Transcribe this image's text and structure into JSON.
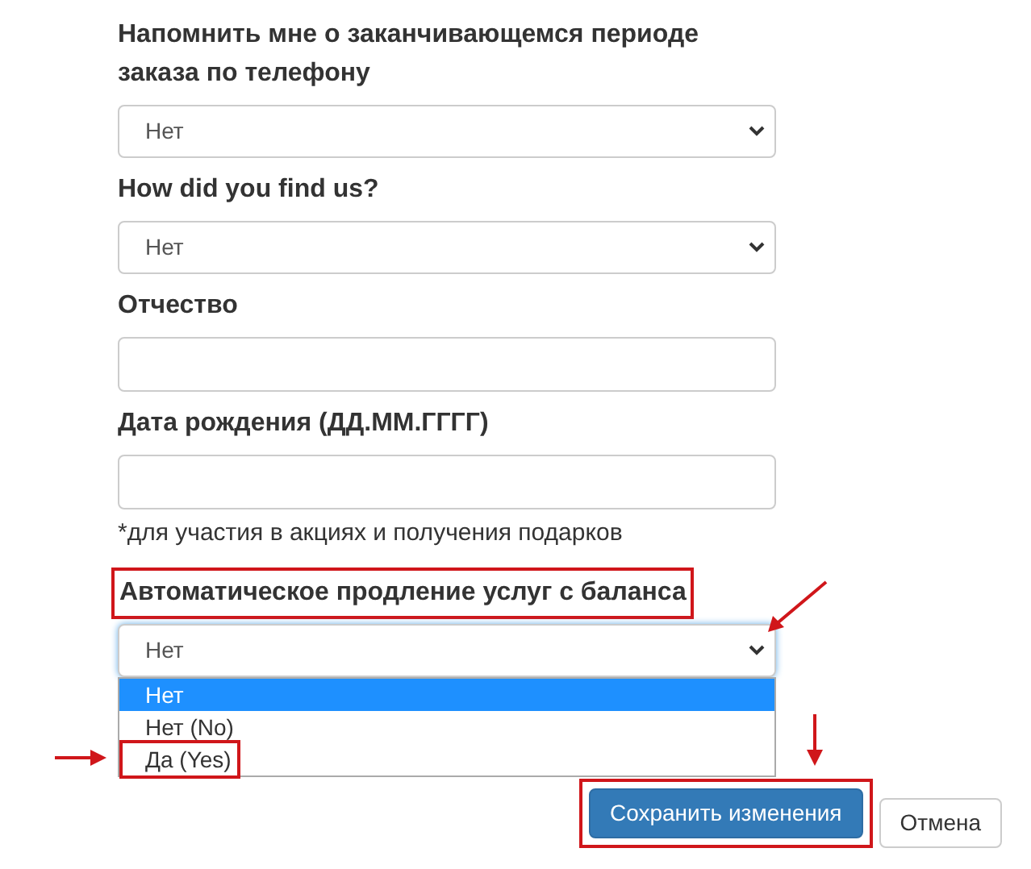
{
  "fields": [
    {
      "kind": "select",
      "label": "Напомнить мне о заканчивающемся периоде заказа по телефону",
      "value": "Нет",
      "highlighted": false
    },
    {
      "kind": "select",
      "label": "How did you find us?",
      "value": "Нет",
      "highlighted": false
    },
    {
      "kind": "text",
      "label": "Отчество",
      "highlighted": false
    },
    {
      "kind": "text",
      "label": "Дата рождения (ДД.ММ.ГГГГ)",
      "note": "*для участия в акциях и получения подарков",
      "highlighted": false
    },
    {
      "kind": "select",
      "label": "Автоматическое продление услуг с баланса",
      "value": "Нет",
      "highlighted": true,
      "expanded": true,
      "options": [
        {
          "label": "Нет",
          "selected": true,
          "highlighted": false
        },
        {
          "label": "Нет (No)",
          "selected": false,
          "highlighted": false
        },
        {
          "label": "Да (Yes)",
          "selected": false,
          "highlighted": true
        }
      ]
    }
  ],
  "buttons": [
    {
      "label": "Сохранить изменения",
      "kind": "primary",
      "highlighted": true
    },
    {
      "label": "Отмена",
      "kind": "default",
      "highlighted": false
    }
  ]
}
